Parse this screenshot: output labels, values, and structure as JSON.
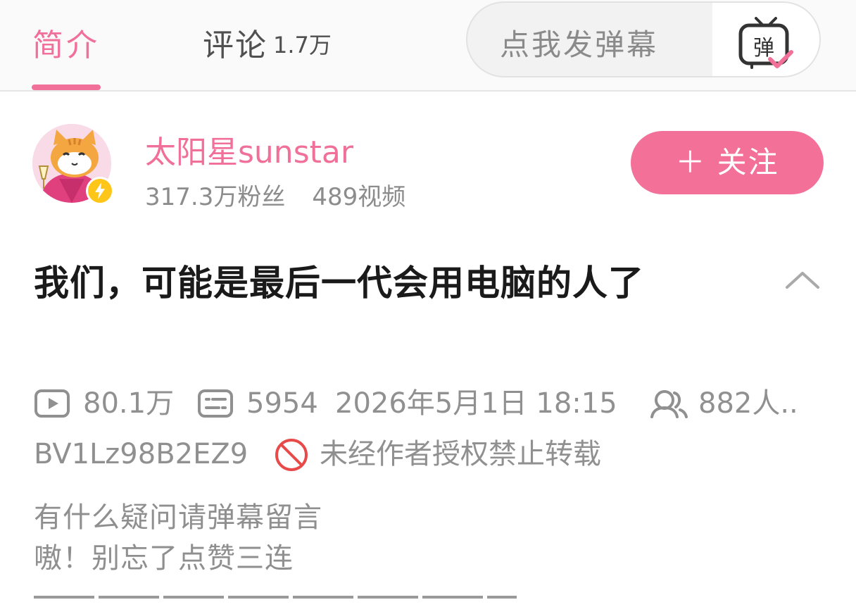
{
  "tabs": {
    "intro_label": "简介",
    "comments_label": "评论",
    "comments_count": "1.7万"
  },
  "danmaku": {
    "placeholder": "点我发弹幕",
    "toggle_glyph": "弹"
  },
  "uploader": {
    "name": "太阳星sunstar",
    "fans": "317.3万粉丝",
    "videos": "489视频",
    "follow_label": "＋ 关注"
  },
  "video": {
    "title": "我们，可能是最后一代会用电脑的人了",
    "views": "80.1万",
    "danmaku_count": "5954",
    "publish_time": "2026年5月1日 18:15",
    "watching": "882人..",
    "bvid": "BV1Lz98B2EZ9",
    "copyright_notice": "未经作者授权禁止转载",
    "description_lines": [
      "有什么疑问请弹幕留言",
      "嗷！别忘了点赞三连"
    ]
  },
  "colors": {
    "accent_pink": "#f0709a",
    "follow_button": "#f37099",
    "muted_text": "#909090",
    "badge_yellow": "#ffc61a",
    "no_repost_red": "#e84a4a"
  },
  "icons": {
    "play": "play-count-icon",
    "danmaku": "danmaku-count-icon",
    "watching": "watching-people-icon",
    "no_repost": "no-repost-icon",
    "collapse": "chevron-up-icon"
  }
}
